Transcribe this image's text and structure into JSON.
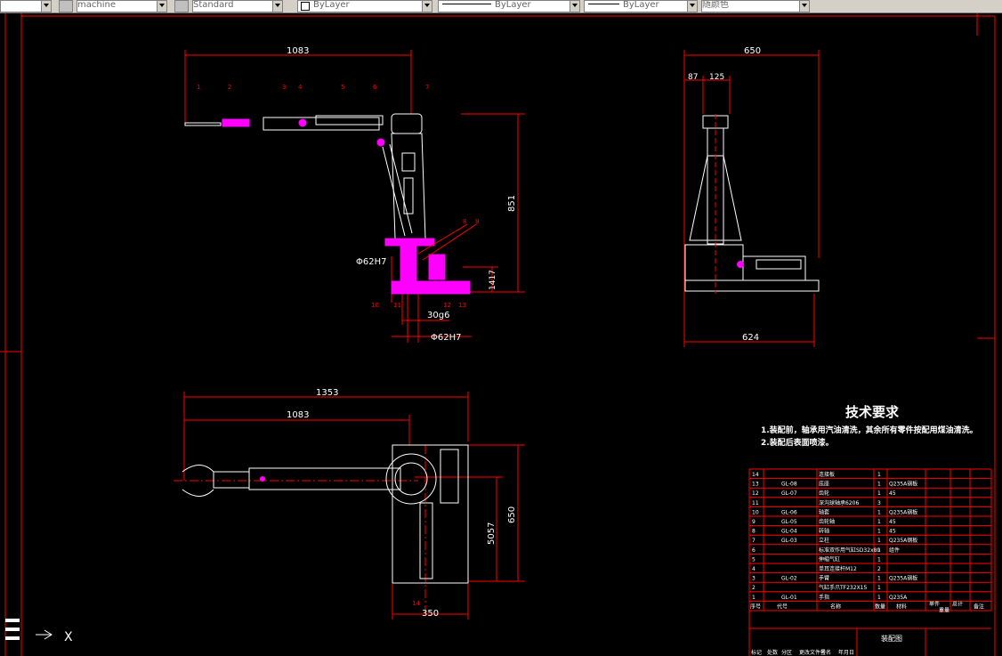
{
  "toolbar": {
    "layer_combo": "",
    "plotstyle_label": "machine",
    "textstyle_label": "Standard",
    "color_label": "ByLayer",
    "linetype_label": "ByLayer",
    "lineweight_label": "ByLayer",
    "plot_color_label": "随颜色"
  },
  "drawing": {
    "front_view": {
      "dim_top": "1083",
      "dim_height": "851",
      "dim_base": "1417",
      "dia_left": "Φ62H7",
      "dim_shaft": "30g6",
      "dia_bottom": "Φ62H7",
      "callouts": [
        "1",
        "2",
        "3",
        "4",
        "5",
        "6",
        "7",
        "8",
        "9",
        "10",
        "11",
        "12",
        "13"
      ]
    },
    "side_view": {
      "dim_top": "650",
      "dim_a": "87",
      "dim_b": "125",
      "dim_bottom": "624"
    },
    "top_view": {
      "dim_total": "1353",
      "dim_arm": "1083",
      "dim_height": "650",
      "dim_inner": "5057",
      "dim_width": "350",
      "callout": "14"
    },
    "tech_requirements": {
      "title": "技术要求",
      "line1": "1.装配前，轴承用汽油清洗，其余所有零件按配用煤油清洗。",
      "line2": "2.装配后表面喷漆。"
    },
    "bom": {
      "rows": [
        {
          "no": "14",
          "code": "",
          "name": "连接板",
          "qty": "1",
          "material": ""
        },
        {
          "no": "13",
          "code": "GL-08",
          "name": "底座",
          "qty": "1",
          "material": "Q235A钢板"
        },
        {
          "no": "12",
          "code": "GL-07",
          "name": "齿轮",
          "qty": "1",
          "material": "45"
        },
        {
          "no": "11",
          "code": "",
          "name": "深沟球轴承6206",
          "qty": "3",
          "material": ""
        },
        {
          "no": "10",
          "code": "GL-06",
          "name": "轴套",
          "qty": "1",
          "material": "Q235A钢板"
        },
        {
          "no": "9",
          "code": "GL-05",
          "name": "齿轮轴",
          "qty": "1",
          "material": "45"
        },
        {
          "no": "8",
          "code": "GL-04",
          "name": "转轴",
          "qty": "1",
          "material": "45"
        },
        {
          "no": "7",
          "code": "GL-03",
          "name": "立柱",
          "qty": "1",
          "material": "Q235A钢板"
        },
        {
          "no": "6",
          "code": "",
          "name": "标准双作用气缸SD32x80",
          "qty": "1",
          "material": "组件"
        },
        {
          "no": "5",
          "code": "",
          "name": "伸缩气缸",
          "qty": "1",
          "material": ""
        },
        {
          "no": "4",
          "code": "",
          "name": "单耳连接杆M12",
          "qty": "2",
          "material": ""
        },
        {
          "no": "3",
          "code": "GL-02",
          "name": "手臂",
          "qty": "1",
          "material": "Q235A钢板"
        },
        {
          "no": "2",
          "code": "",
          "name": "气缸手爪TF232X15",
          "qty": "1",
          "material": ""
        },
        {
          "no": "1",
          "code": "GL-01",
          "name": "手指",
          "qty": "1",
          "material": "Q235A"
        }
      ],
      "header": {
        "no": "序号",
        "code": "代号",
        "name": "名称",
        "qty": "数量",
        "material": "材料",
        "unit": "单件",
        "total": "总计",
        "note": "备注",
        "weight": "重量"
      },
      "title_block": "装配图",
      "title_left": [
        "标记",
        "处数",
        "分区",
        "更改文件号",
        "签名",
        "年月日"
      ]
    },
    "ucs": {
      "x_label": "X"
    }
  },
  "colors": {
    "background": "#000000",
    "line": "#ffffff",
    "dimension": "#ff0000",
    "highlight": "#ff00ff",
    "border": "#ff0000"
  }
}
